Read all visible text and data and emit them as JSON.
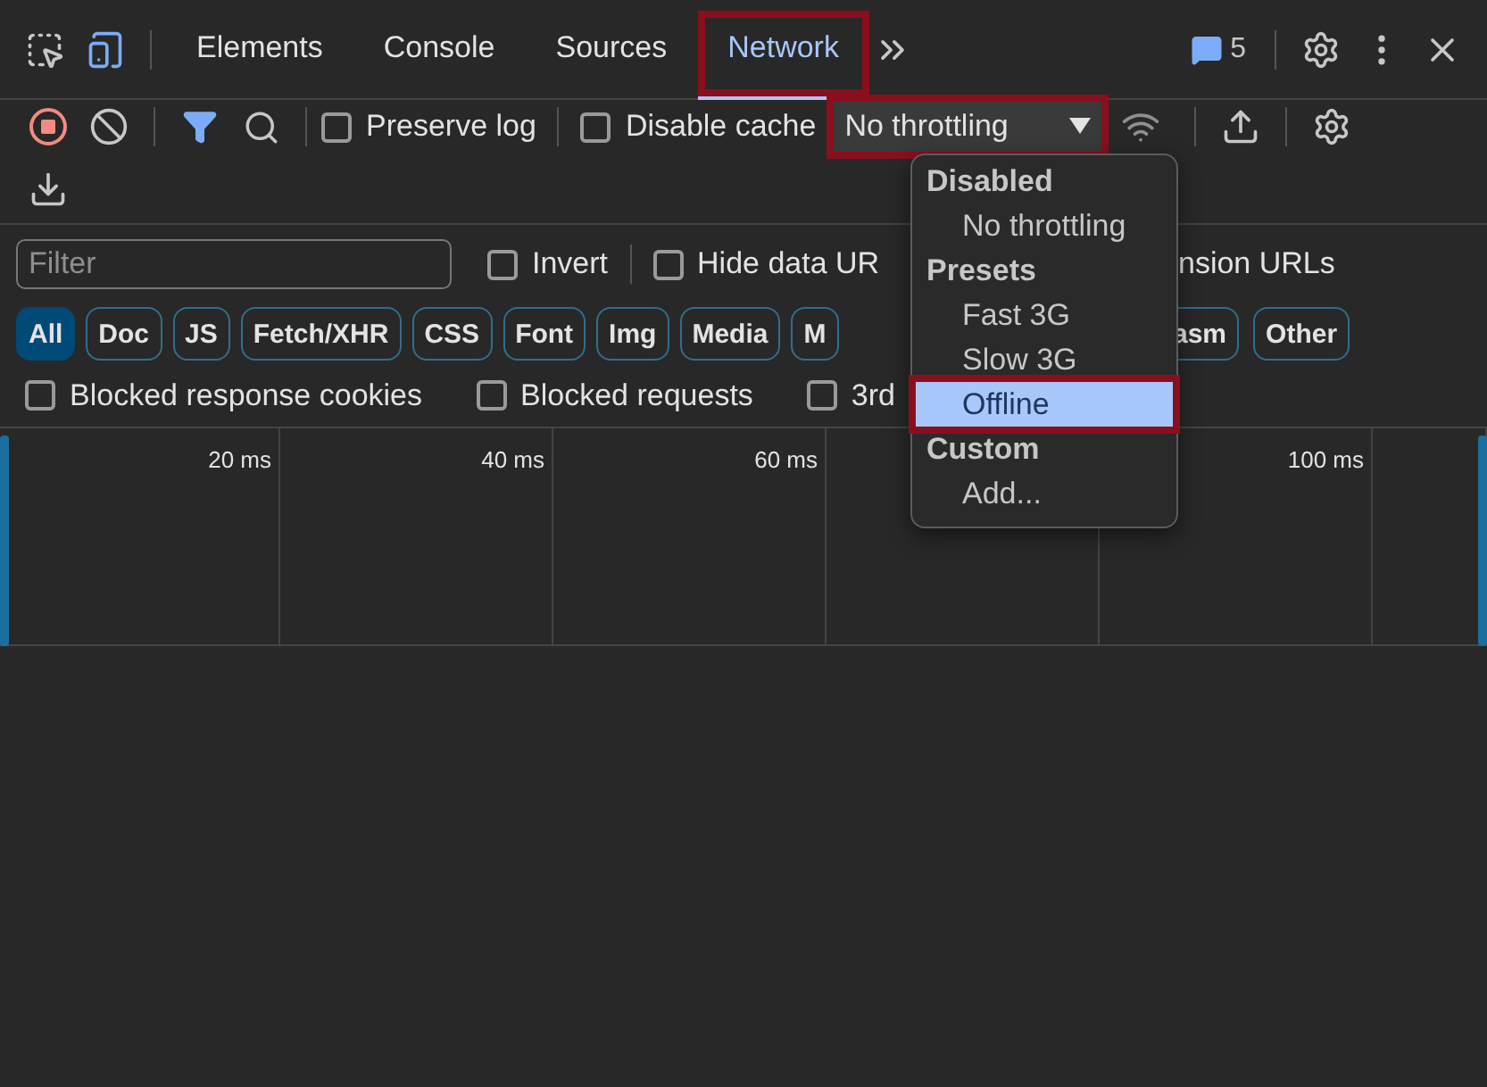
{
  "panel_tabs": [
    {
      "label": "Elements",
      "selected": false,
      "annotated": false
    },
    {
      "label": "Console",
      "selected": false,
      "annotated": false
    },
    {
      "label": "Sources",
      "selected": false,
      "annotated": false
    },
    {
      "label": "Network",
      "selected": true,
      "annotated": true
    }
  ],
  "message_count": "5",
  "toolbar": {
    "recording": true,
    "preserve_log": {
      "label": "Preserve log",
      "checked": false
    },
    "disable_cache": {
      "label": "Disable cache",
      "checked": false
    },
    "throttling": {
      "value": "No throttling",
      "annotated": true
    }
  },
  "filter": {
    "placeholder": "Filter",
    "invert": {
      "label": "Invert",
      "checked": false
    },
    "hide_data_urls": {
      "label": "Hide data UR",
      "checked": false
    },
    "hide_extension_urls": {
      "label": "nsion URLs"
    }
  },
  "type_filters": [
    {
      "label": "All",
      "selected": true
    },
    {
      "label": "Doc",
      "selected": false
    },
    {
      "label": "JS",
      "selected": false
    },
    {
      "label": "Fetch/XHR",
      "selected": false
    },
    {
      "label": "CSS",
      "selected": false
    },
    {
      "label": "Font",
      "selected": false
    },
    {
      "label": "Img",
      "selected": false
    },
    {
      "label": "Media",
      "selected": false
    },
    {
      "label": "M",
      "selected": false
    },
    {
      "label": "asm",
      "selected": false
    },
    {
      "label": "Other",
      "selected": false
    }
  ],
  "blocked_filters": [
    {
      "label": "Blocked response cookies",
      "checked": false
    },
    {
      "label": "Blocked requests",
      "checked": false
    },
    {
      "label": "3rd",
      "checked": false
    }
  ],
  "timeline": {
    "columns": [
      {
        "kind": "tick",
        "tick": "20 ms"
      },
      {
        "kind": "tick",
        "tick": "40 ms"
      },
      {
        "kind": "tick",
        "tick": "60 ms"
      },
      {
        "kind": "blank"
      },
      {
        "kind": "tick",
        "tick": "100 ms"
      },
      {
        "kind": "blank"
      }
    ]
  },
  "throttling_menu": {
    "groups": [
      {
        "heading": "Disabled",
        "options": [
          {
            "label": "No throttling",
            "selected": false,
            "annotated": false
          }
        ]
      },
      {
        "heading": "Presets",
        "options": [
          {
            "label": "Fast 3G",
            "selected": false,
            "annotated": false
          },
          {
            "label": "Slow 3G",
            "selected": false,
            "annotated": false
          },
          {
            "label": "Offline",
            "selected": true,
            "annotated": true
          }
        ]
      },
      {
        "heading": "Custom",
        "options": [
          {
            "label": "Add...",
            "selected": false,
            "annotated": false
          }
        ]
      }
    ]
  }
}
